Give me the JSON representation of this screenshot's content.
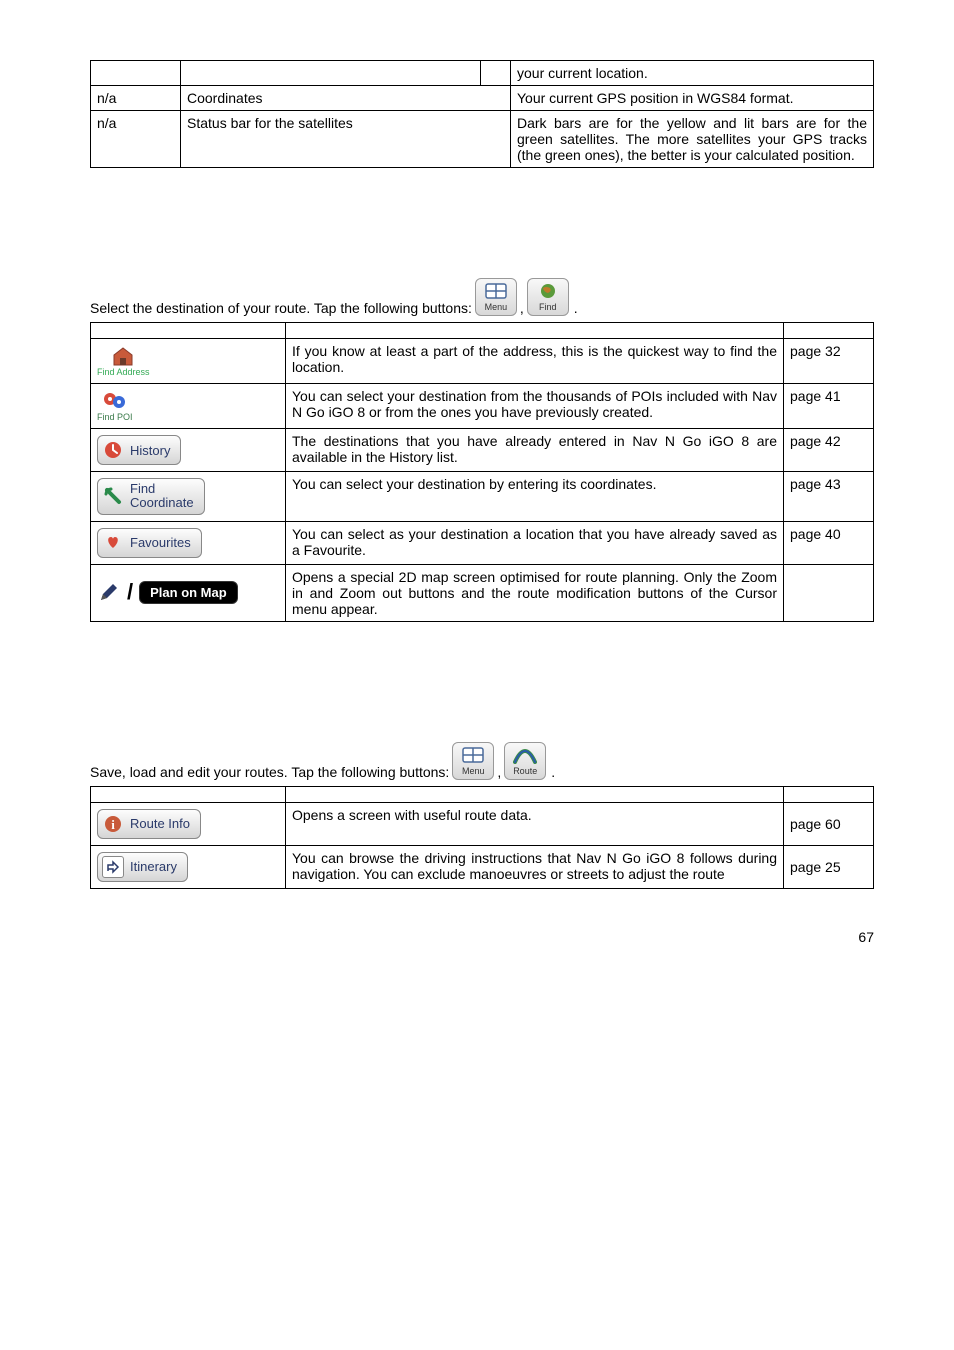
{
  "table1": {
    "rows": [
      {
        "c1": "",
        "c2": "",
        "c3": "",
        "c4": "your current location."
      },
      {
        "c1": "n/a",
        "c2": "Coordinates",
        "c3": "",
        "c4": "Your current GPS position in WGS84 format."
      },
      {
        "c1": "n/a",
        "c2": "Status bar for the satellites",
        "c3": "",
        "c4": "Dark bars are for the yellow and lit bars are for the green satellites. The more satellites your GPS tracks (the green ones), the better is your calculated position."
      }
    ]
  },
  "section2_intro": "Select the destination of your route. Tap the following buttons:",
  "menu_btn": {
    "label": "Menu"
  },
  "find_btn": {
    "label": "Find"
  },
  "table2": {
    "rows": [
      {
        "icon": "find-address",
        "label": "Find Address",
        "desc": "If you know at least a part of the address, this is the quickest way to find the location.",
        "ref": "page 32"
      },
      {
        "icon": "find-poi",
        "label": "Find POI",
        "desc": "You can select your destination from the thousands of POIs included with Nav N Go iGO 8 or from the ones you have previously created.",
        "ref": "page 41"
      },
      {
        "icon": "history",
        "label": "History",
        "desc": "The destinations that you have already entered in Nav N Go iGO 8 are available in the History list.",
        "ref": "page 42"
      },
      {
        "icon": "find-coord",
        "label": "Find\nCoordinate",
        "desc": "You can select your destination by entering its coordinates.",
        "ref": "page 43"
      },
      {
        "icon": "favourites",
        "label": "Favourites",
        "desc": "You can select as your destination a location that you have already saved as a Favourite.",
        "ref": "page 40"
      },
      {
        "icon": "plan-on-map",
        "label": "Plan on Map",
        "desc": "Opens a special 2D map screen optimised for route planning. Only the Zoom in and Zoom out buttons and the route modification buttons of the Cursor menu appear.",
        "ref": ""
      }
    ]
  },
  "section3_intro": "Save, load and edit your routes. Tap the following buttons:",
  "route_btn": {
    "label": "Route"
  },
  "table3": {
    "rows": [
      {
        "icon": "route-info",
        "label": "Route Info",
        "desc": "Opens a screen with useful route data.",
        "ref": "page 60"
      },
      {
        "icon": "itinerary",
        "label": "Itinerary",
        "desc": "You can browse the driving instructions that Nav N Go iGO 8 follows during navigation. You can exclude manoeuvres or streets to adjust the route",
        "ref": "page 25"
      }
    ]
  },
  "pageNumber": "67",
  "comma": ","
}
